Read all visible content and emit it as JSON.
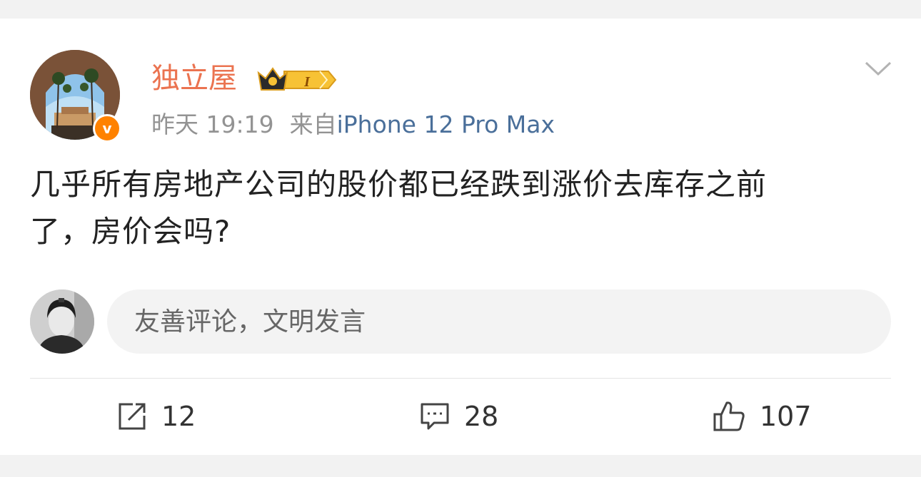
{
  "post": {
    "author": "独立屋",
    "badge_level": "I",
    "time": "昨天 19:19",
    "source_prefix": "来自",
    "source": "iPhone 12 Pro Max",
    "verified_mark": "v",
    "text_line1": "几乎所有房地产公司的股价都已经跌到涨价去库存之前",
    "text_line2": "了，房价会吗?"
  },
  "comment": {
    "placeholder": "友善评论，文明发言"
  },
  "actions": {
    "repost_count": "12",
    "comment_count": "28",
    "like_count": "107"
  },
  "icons": {
    "more": "chevron-down-icon",
    "repost": "share-icon",
    "comment": "comment-icon",
    "like": "thumbs-up-icon"
  },
  "colors": {
    "username": "#eb7350",
    "source_link": "#4a6f9a",
    "verified": "#ff8200",
    "badge_gold": "#f7c235"
  }
}
